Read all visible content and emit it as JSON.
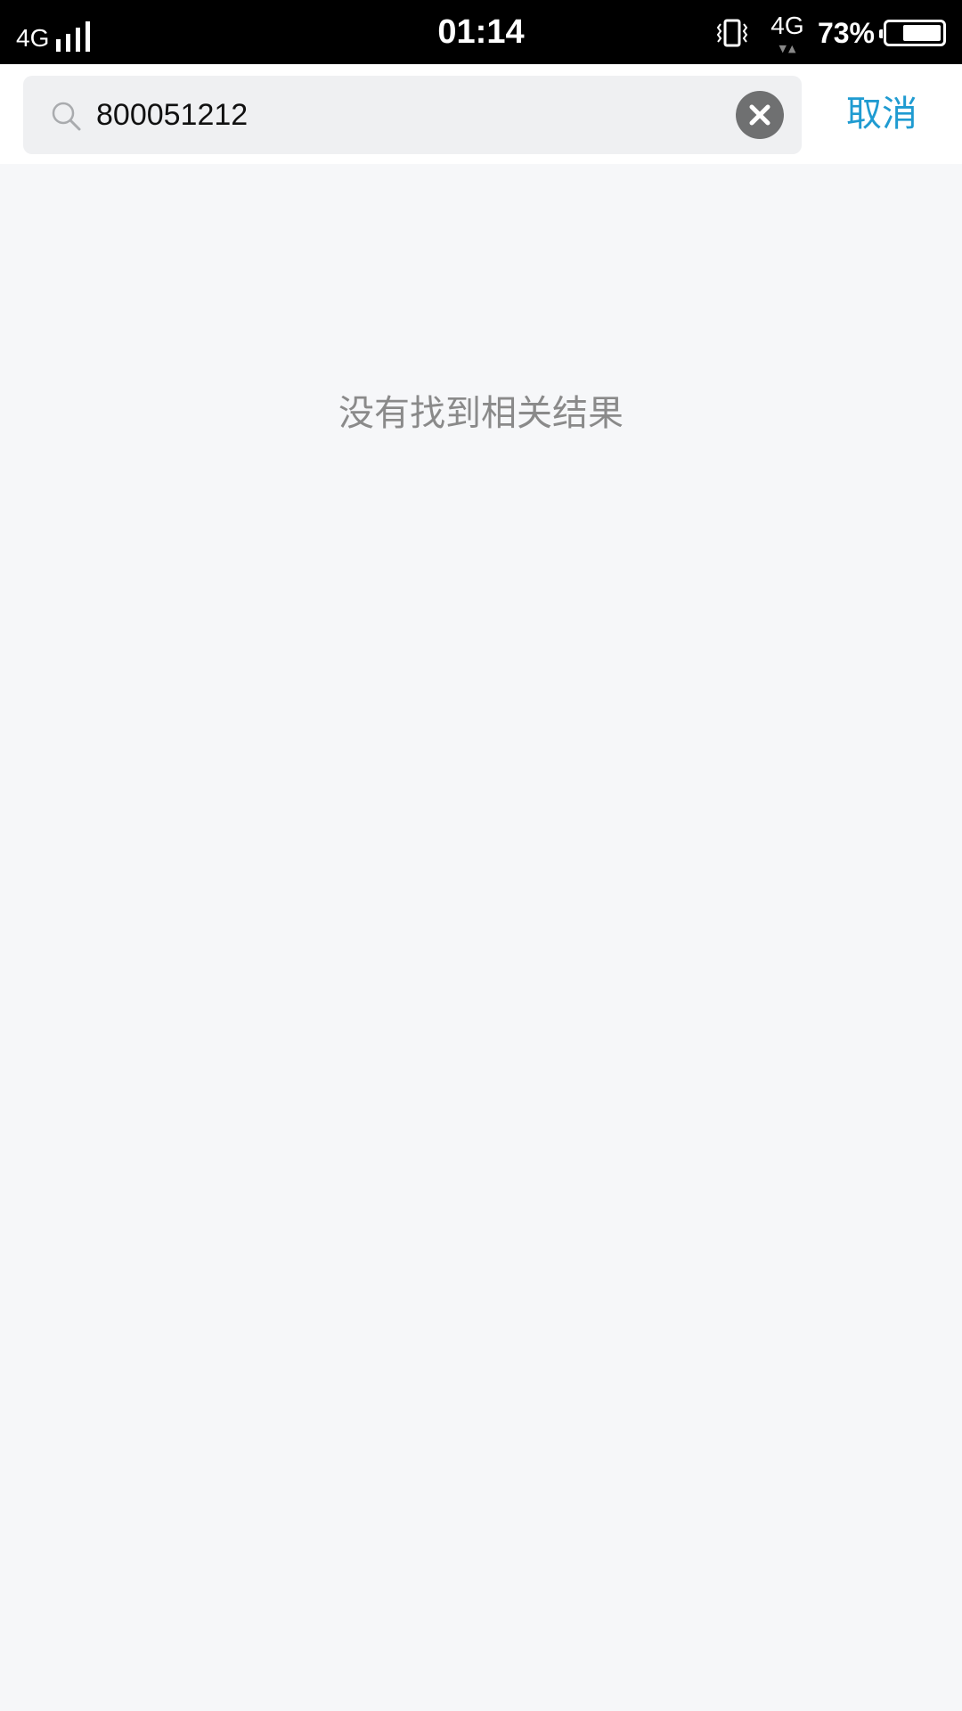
{
  "status_bar": {
    "network_left": "4G",
    "signal_bars": 4,
    "time": "01:14",
    "vibrate_icon": "vibrate-icon",
    "network_right": "4G",
    "network_arrows": "▼▲",
    "battery_percent_label": "73%",
    "battery_level": 0.73
  },
  "search": {
    "icon": "search-icon",
    "query": "800051212",
    "clear_icon": "close-circle-icon",
    "cancel_label": "取消"
  },
  "results": {
    "empty_message": "没有找到相关结果"
  },
  "colors": {
    "accent": "#1f9bd1",
    "status_bar_bg": "#000000",
    "page_bg": "#f6f7f9",
    "search_box_bg": "#eff0f2",
    "empty_text": "#8a8a8a"
  }
}
